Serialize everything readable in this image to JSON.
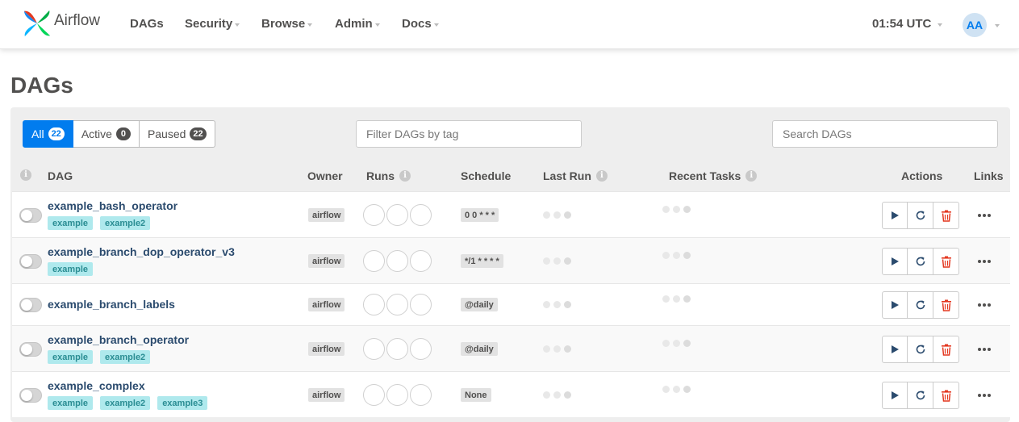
{
  "navbar": {
    "brand": "Airflow",
    "items": [
      {
        "label": "DAGs",
        "caret": false
      },
      {
        "label": "Security",
        "caret": true
      },
      {
        "label": "Browse",
        "caret": true
      },
      {
        "label": "Admin",
        "caret": true
      },
      {
        "label": "Docs",
        "caret": true
      }
    ],
    "time": "01:54 UTC",
    "user_initials": "AA"
  },
  "page": {
    "title": "DAGs"
  },
  "filters": [
    {
      "label": "All",
      "count": "22",
      "active": true
    },
    {
      "label": "Active",
      "count": "0",
      "active": false
    },
    {
      "label": "Paused",
      "count": "22",
      "active": false
    }
  ],
  "tag_filter": {
    "placeholder": "Filter DAGs by tag"
  },
  "search": {
    "placeholder": "Search DAGs"
  },
  "table": {
    "headers": {
      "dag": "DAG",
      "owner": "Owner",
      "runs": "Runs",
      "schedule": "Schedule",
      "last_run": "Last Run",
      "recent_tasks": "Recent Tasks",
      "actions": "Actions",
      "links": "Links"
    },
    "rows": [
      {
        "name": "example_bash_operator",
        "tags": [
          "example",
          "example2"
        ],
        "owner": "airflow",
        "schedule": "0 0 * * *"
      },
      {
        "name": "example_branch_dop_operator_v3",
        "tags": [
          "example"
        ],
        "owner": "airflow",
        "schedule": "*/1 * * * *"
      },
      {
        "name": "example_branch_labels",
        "tags": [],
        "owner": "airflow",
        "schedule": "@daily"
      },
      {
        "name": "example_branch_operator",
        "tags": [
          "example",
          "example2"
        ],
        "owner": "airflow",
        "schedule": "@daily"
      },
      {
        "name": "example_complex",
        "tags": [
          "example",
          "example2",
          "example3"
        ],
        "owner": "airflow",
        "schedule": "None"
      }
    ]
  },
  "colors": {
    "accent": "#017cee",
    "tag_bg": "#afe9ed",
    "tag_text": "#2a8d93",
    "delete": "#e43921"
  }
}
